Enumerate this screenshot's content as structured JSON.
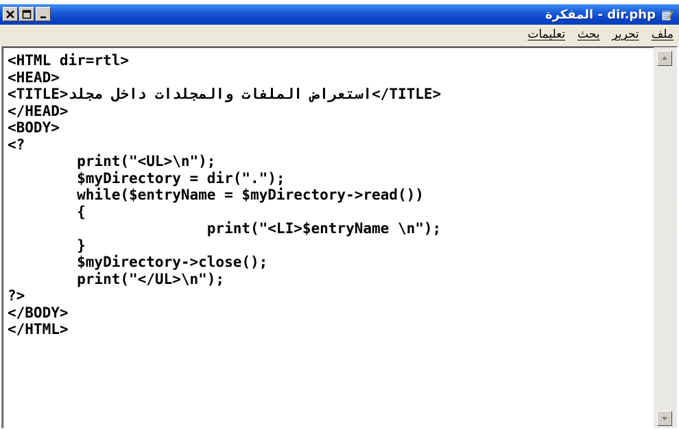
{
  "window": {
    "title": "المفكرة - dir.php"
  },
  "menu": {
    "items": [
      "ملف",
      "تحرير",
      "بحث",
      "تعليمات"
    ]
  },
  "editor": {
    "lines": [
      "<HTML dir=rtl>",
      "<HEAD>",
      "<TITLE>استعراض الملفات والمجلدات داخل مجلد</TITLE>",
      "</HEAD>",
      "<BODY>",
      "<?",
      "        print(\"<UL>\\n\");",
      "        $myDirectory = dir(\".\");",
      "        while($entryName = $myDirectory->read())",
      "        {",
      "                       print(\"<LI>$entryName \\n\");",
      "        }",
      "        $myDirectory->close();",
      "        print(\"</UL>\\n\");",
      "?>",
      "</BODY>",
      "</HTML>"
    ]
  },
  "icons": {
    "app": "notepad-icon",
    "close": "close-icon",
    "maximize": "maximize-icon",
    "minimize": "minimize-icon",
    "scroll_up": "arrow-up-icon",
    "scroll_down": "arrow-down-icon"
  },
  "colors": {
    "titlebar": "#0a3fbf",
    "menubar": "#ece9d8",
    "scrollbar_button": "#d4d0c8"
  }
}
